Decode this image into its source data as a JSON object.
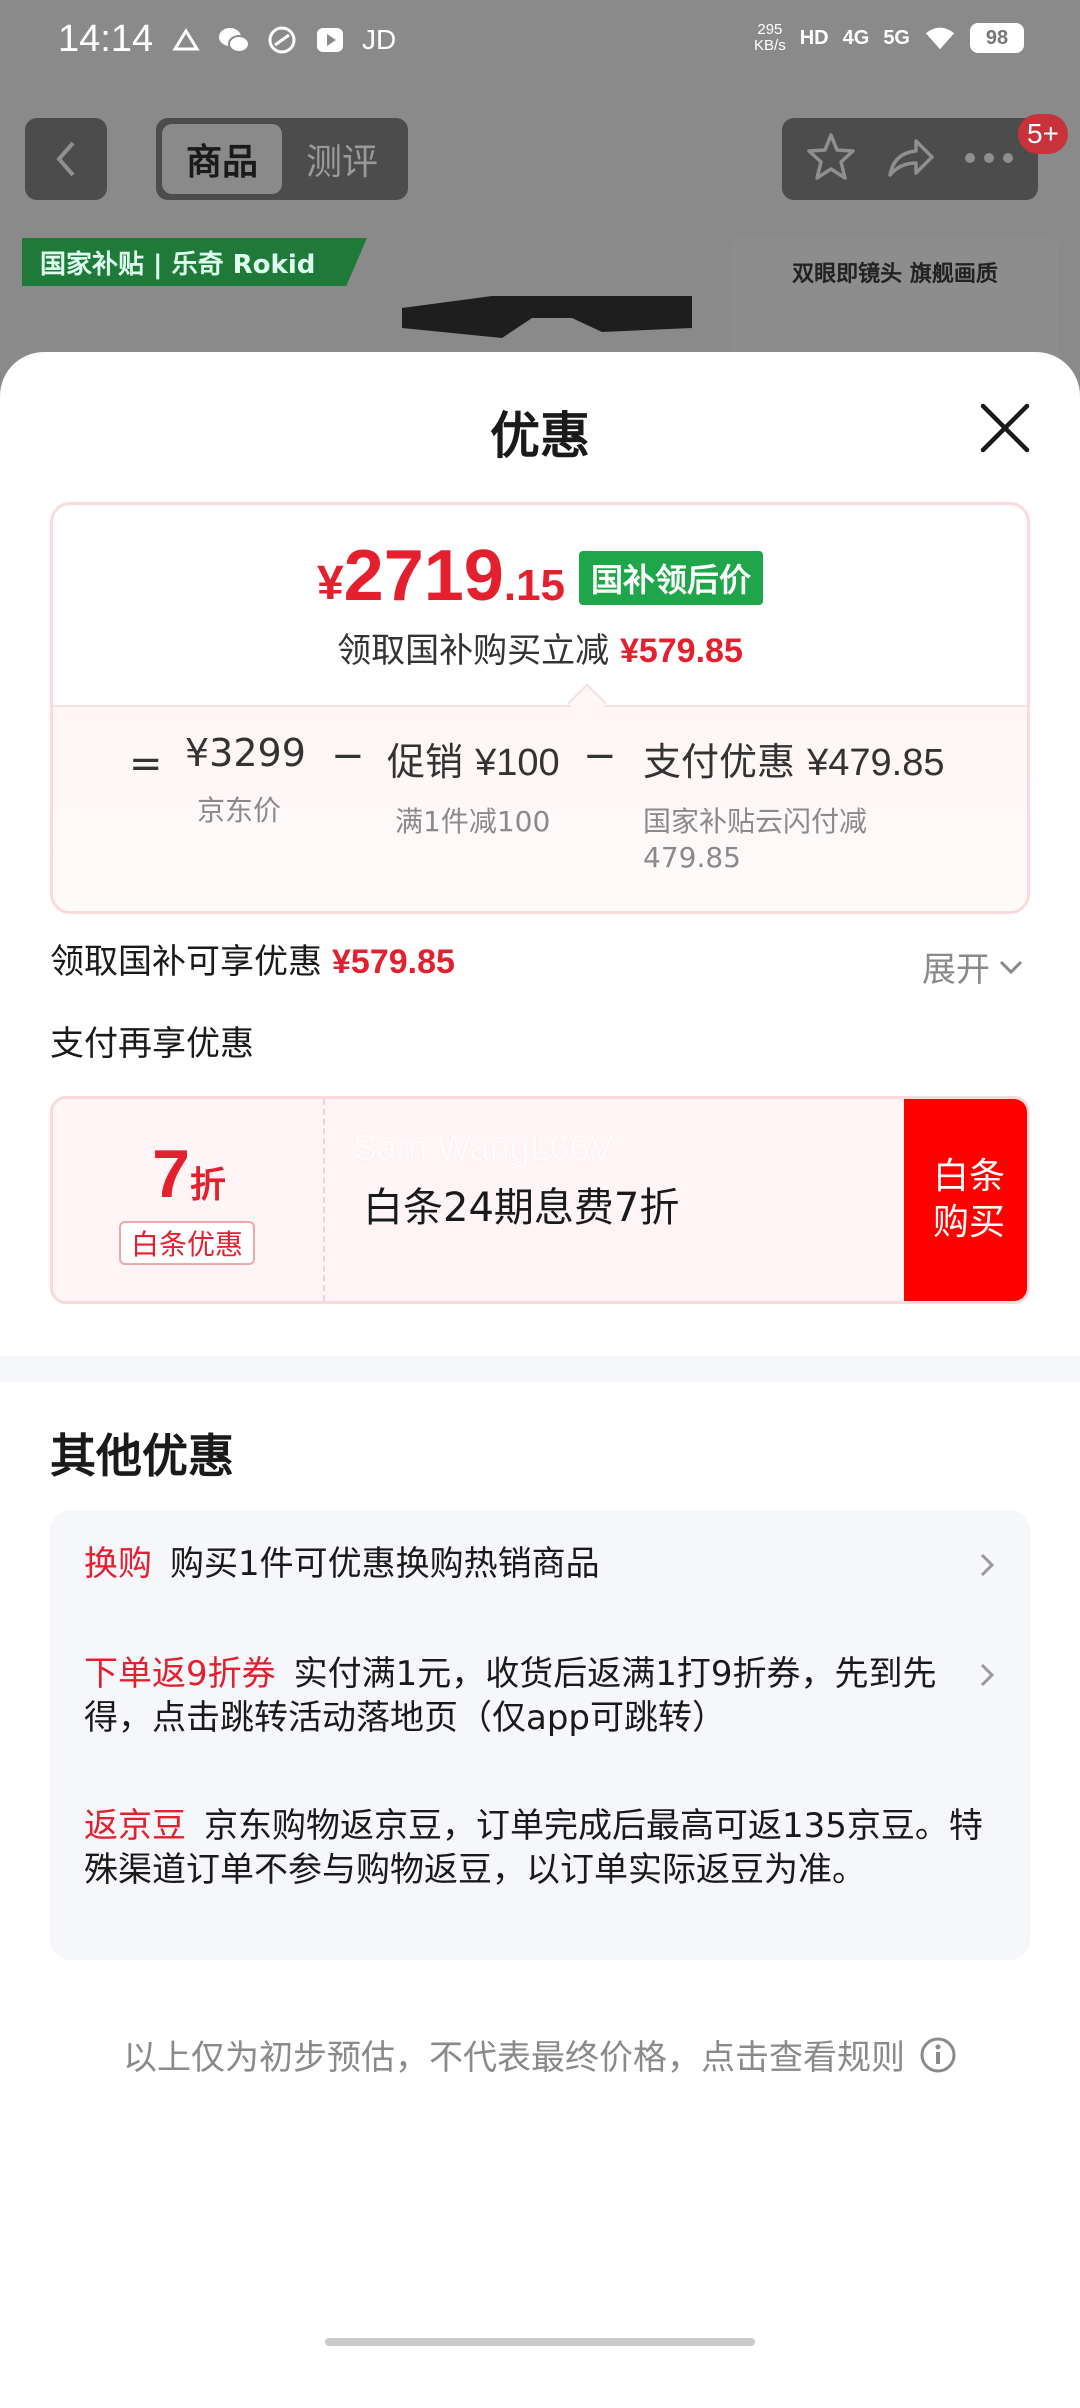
{
  "status_bar": {
    "time": "14:14",
    "carrier": "JD",
    "net_speed_top": "295",
    "net_speed_unit": "KB/s",
    "hd_label": "HD",
    "sig1": "4G",
    "sig2": "5G",
    "battery": "98"
  },
  "nav": {
    "tab_goods": "商品",
    "tab_review": "测评",
    "badge": "5+"
  },
  "product": {
    "banner": "国家补贴 | 乐奇 Rokid",
    "side_title": "双眼即镜头 旗舰画质"
  },
  "sheet": {
    "title": "优惠",
    "price": {
      "yen": "¥",
      "integer": "2719",
      "decimal": ".15",
      "tag": "国补领后价",
      "sub_text": "领取国补购买立减",
      "sub_amount": "¥579.85"
    },
    "breakdown": {
      "equals": "=",
      "jd_price": "¥3299",
      "jd_price_label": "京东价",
      "minus": "−",
      "promo_label": "促销",
      "promo_amount": "¥100",
      "promo_sub": "满1件减100",
      "pay_label": "支付优惠",
      "pay_amount": "¥479.85",
      "pay_sub_1": "国家补贴云闪付减",
      "pay_sub_2": "479.85"
    },
    "claim_text": "领取国补可享优惠",
    "claim_amount": "¥579.85",
    "expand": "展开",
    "pay_more": "支付再享优惠",
    "baitiao": {
      "discount_num": "7",
      "discount_unit": "折",
      "label": "白条优惠",
      "text": "白条24期息费7折",
      "watermark": "Sam.WangL66V",
      "button_line1": "白条",
      "button_line2": "购买"
    },
    "other_title": "其他优惠",
    "offers": [
      {
        "keyword": "换购",
        "text": "购买1件可优惠换购热销商品"
      },
      {
        "keyword": "下单返9折券",
        "text": "实付满1元，收货后返满1打9折券，先到先得，点击跳转活动落地页（仅app可跳转）"
      },
      {
        "keyword": "返京豆",
        "text": "京东购物返京豆，订单完成后最高可返135京豆。特殊渠道订单不参与购物返豆，以订单实际返豆为准。"
      }
    ],
    "disclaimer": "以上仅为初步预估，不代表最终价格，点击查看规则"
  },
  "colors": {
    "accent_red": "#e4202f",
    "green_tag": "#1fa64a",
    "button_red": "#ff0000"
  }
}
